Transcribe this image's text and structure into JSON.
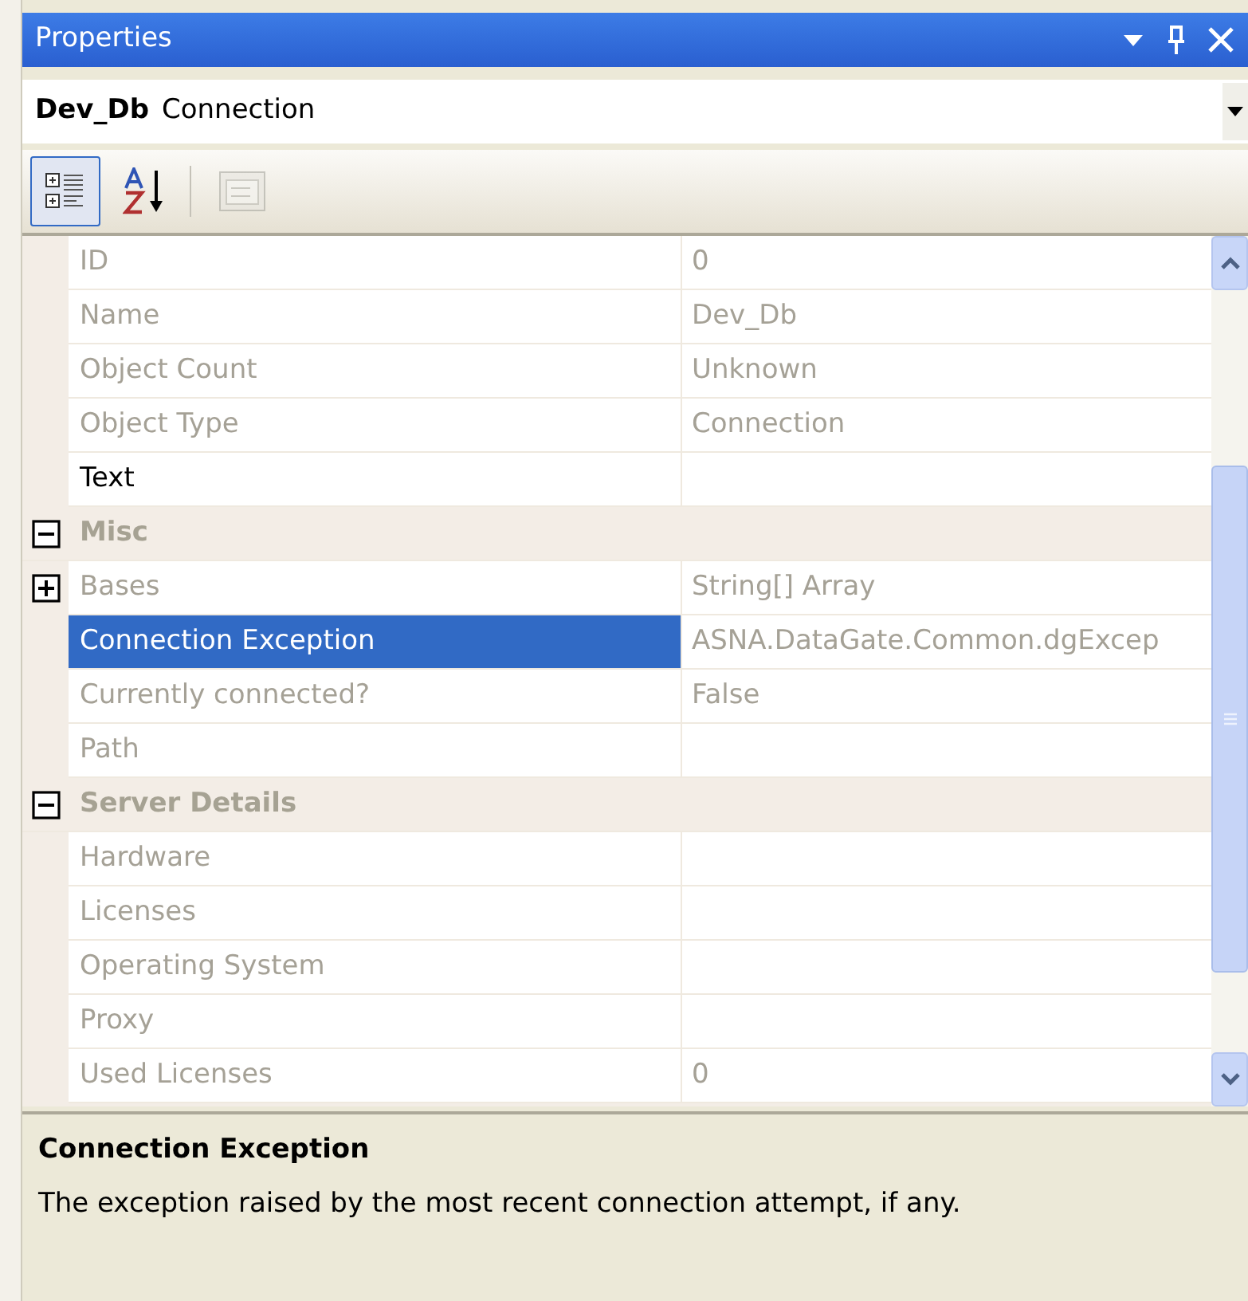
{
  "window": {
    "title": "Properties"
  },
  "object_selector": {
    "name": "Dev_Db",
    "type": "Connection"
  },
  "toolbar": [
    {
      "kind": "categorized",
      "selected": true,
      "disabled": false
    },
    {
      "kind": "alphabetical",
      "selected": false,
      "disabled": false
    },
    {
      "kind": "property-pages",
      "selected": false,
      "disabled": true
    }
  ],
  "grid": {
    "rows": [
      {
        "kind": "property",
        "name": "ID",
        "value": "0",
        "readonly": true,
        "selected": false
      },
      {
        "kind": "property",
        "name": "Name",
        "value": "Dev_Db",
        "readonly": true,
        "selected": false
      },
      {
        "kind": "property",
        "name": "Object Count",
        "value": "Unknown",
        "readonly": true,
        "selected": false
      },
      {
        "kind": "property",
        "name": "Object Type",
        "value": "Connection",
        "readonly": true,
        "selected": false
      },
      {
        "kind": "property",
        "name": "Text",
        "readonly": false,
        "selected": false
      },
      {
        "kind": "category",
        "name": "Misc",
        "expanded": true
      },
      {
        "kind": "property",
        "name": "Bases",
        "value": "String[] Array",
        "readonly": true,
        "selected": false,
        "expanded": false
      },
      {
        "kind": "property",
        "name": "Connection Exception",
        "value": "ASNA.DataGate.Common.dgExcep",
        "readonly": true,
        "selected": true
      },
      {
        "kind": "property",
        "name": "Currently connected?",
        "value": "False",
        "readonly": true,
        "selected": false
      },
      {
        "kind": "property",
        "name": "Path",
        "readonly": true,
        "selected": false
      },
      {
        "kind": "category",
        "name": "Server Details",
        "expanded": true
      },
      {
        "kind": "property",
        "name": "Hardware",
        "readonly": true,
        "selected": false
      },
      {
        "kind": "property",
        "name": "Licenses",
        "readonly": true,
        "selected": false
      },
      {
        "kind": "property",
        "name": "Operating System",
        "readonly": true,
        "selected": false
      },
      {
        "kind": "property",
        "name": "Proxy",
        "readonly": true,
        "selected": false
      },
      {
        "kind": "property",
        "name": "Used Licenses",
        "value": "0",
        "readonly": true,
        "selected": false
      }
    ]
  },
  "description": {
    "title": "Connection Exception",
    "text": "The exception raised by the most recent connection attempt, if any."
  }
}
